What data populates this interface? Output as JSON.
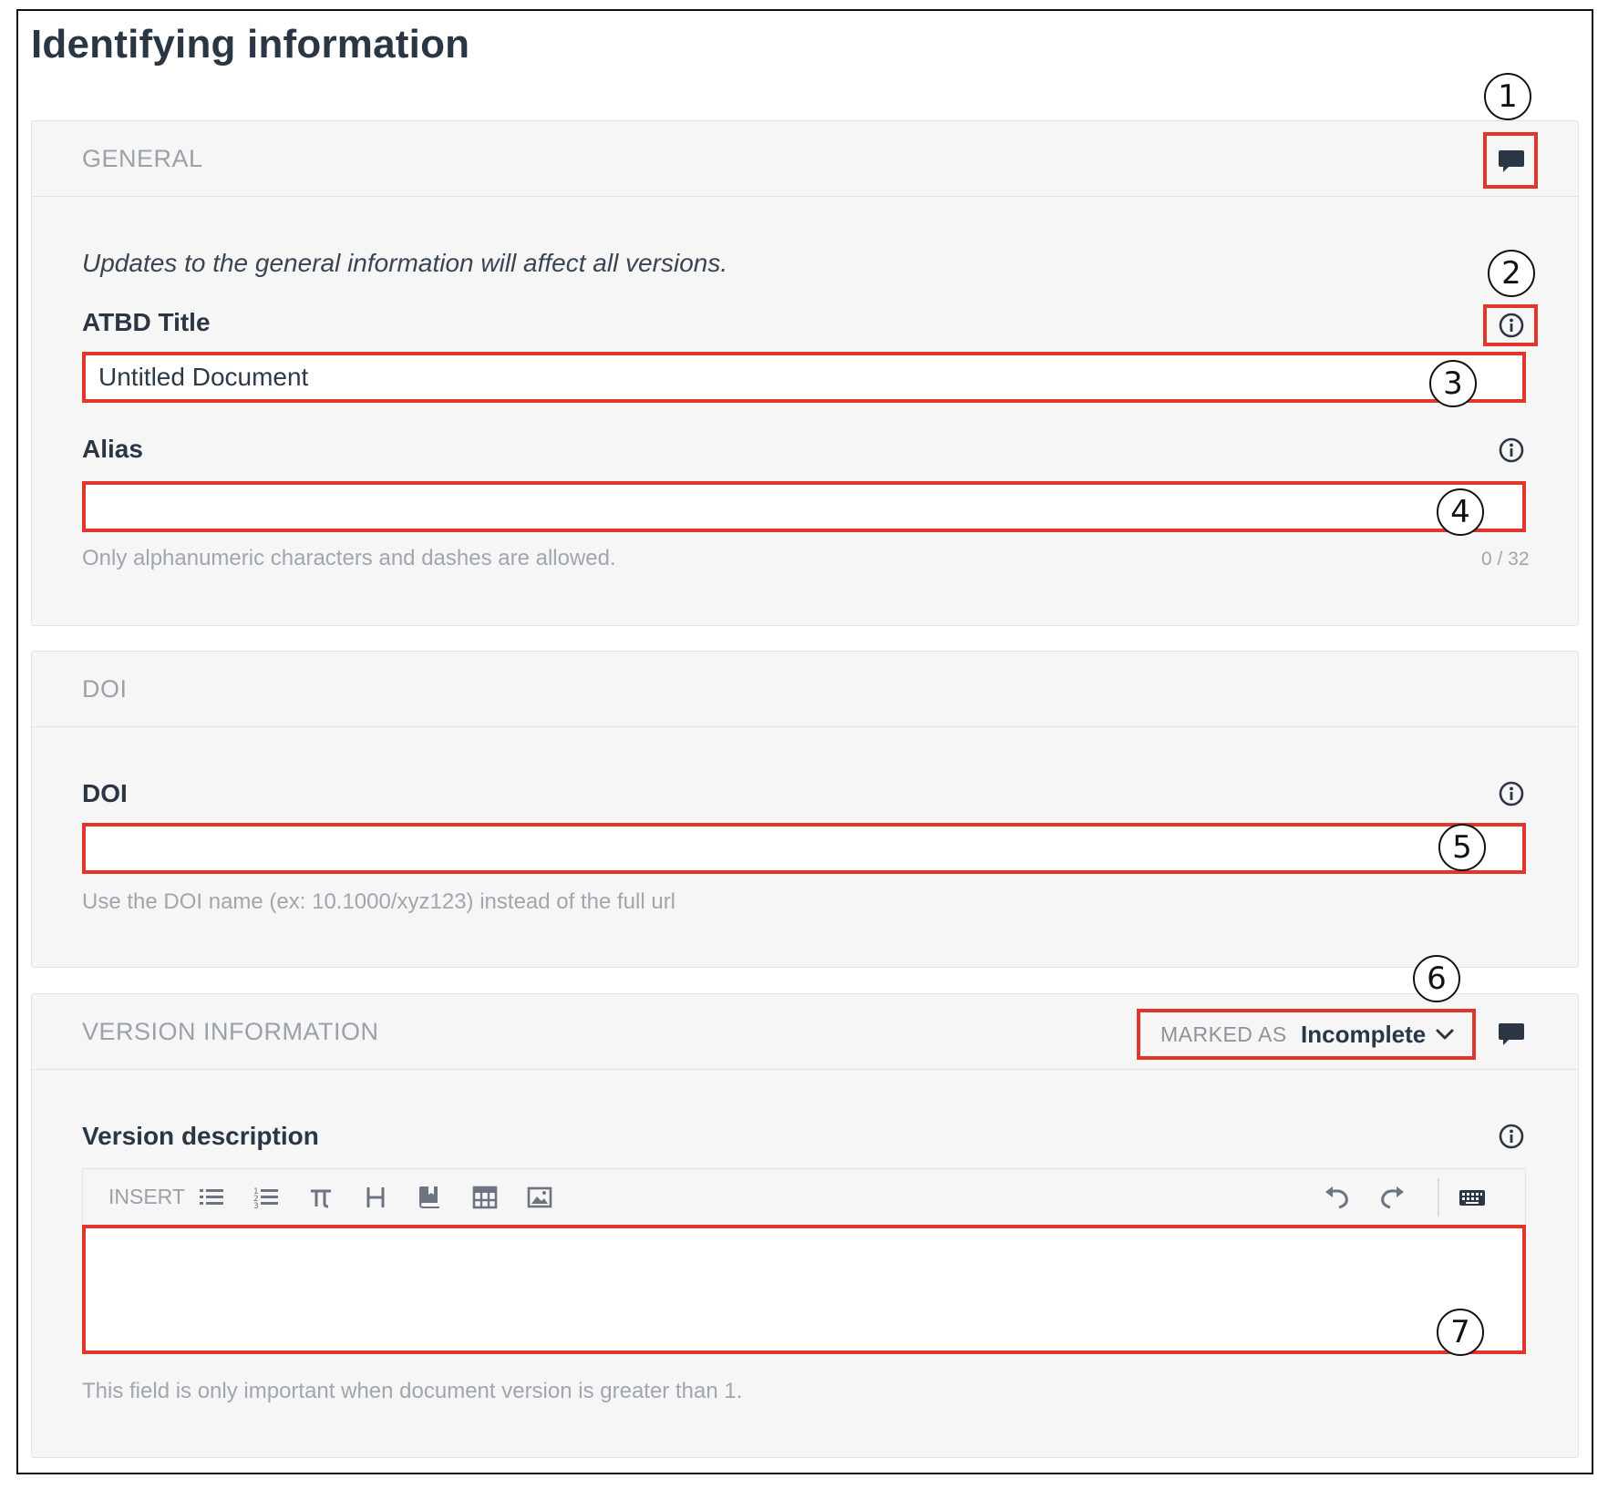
{
  "page": {
    "title": "Identifying information"
  },
  "colors": {
    "highlight": "#e0362c",
    "text": "#2b3644",
    "muted": "#9aa1aa",
    "panel": "#f6f6f7"
  },
  "general": {
    "title": "GENERAL",
    "comment_icon": "comment-icon",
    "note": "Updates to the general information will affect all versions.",
    "atbd_title": {
      "label": "ATBD Title",
      "value": "Untitled Document",
      "info_icon": "info-icon"
    },
    "alias": {
      "label": "Alias",
      "value": "",
      "hint": "Only alphanumeric characters and dashes are allowed.",
      "counter": "0 / 32",
      "info_icon": "info-icon"
    }
  },
  "doi": {
    "title": "DOI",
    "field": {
      "label": "DOI",
      "value": "",
      "hint": "Use the DOI name (ex: 10.1000/xyz123) instead of the full url",
      "info_icon": "info-icon"
    }
  },
  "version_info": {
    "title": "VERSION INFORMATION",
    "status_prefix": "MARKED AS",
    "status_value": "Incomplete",
    "comment_icon": "comment-icon",
    "description": {
      "label": "Version description",
      "hint": "This field is only important when document version is greater than 1.",
      "info_icon": "info-icon"
    },
    "toolbar": {
      "insert_label": "INSERT",
      "icons": [
        "bulleted-list-icon",
        "numbered-list-icon",
        "pi-equation-icon",
        "heading-icon",
        "reference-book-icon",
        "table-icon",
        "image-icon",
        "undo-icon",
        "redo-icon",
        "keyboard-shortcuts-icon"
      ]
    }
  },
  "callouts": [
    "1",
    "2",
    "3",
    "4",
    "5",
    "6",
    "7"
  ]
}
